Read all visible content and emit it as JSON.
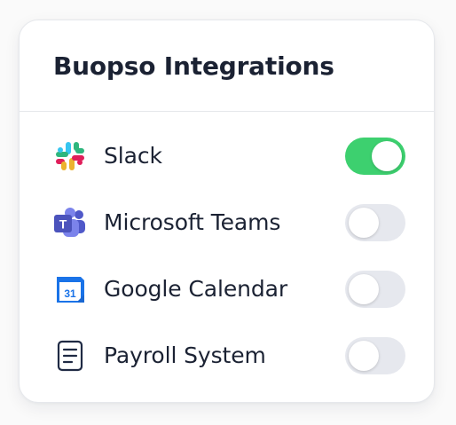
{
  "card": {
    "title": "Buopso Integrations"
  },
  "integrations": [
    {
      "label": "Slack",
      "icon": "slack-icon",
      "enabled": true
    },
    {
      "label": "Microsoft Teams",
      "icon": "microsoft-teams-icon",
      "enabled": false
    },
    {
      "label": "Google Calendar",
      "icon": "google-calendar-icon",
      "calendar_day": "31",
      "enabled": false
    },
    {
      "label": "Payroll System",
      "icon": "document-icon",
      "enabled": false
    }
  ],
  "colors": {
    "toggle_on": "#3dd06f",
    "toggle_off": "#e6e8ee",
    "text": "#1b2233"
  }
}
